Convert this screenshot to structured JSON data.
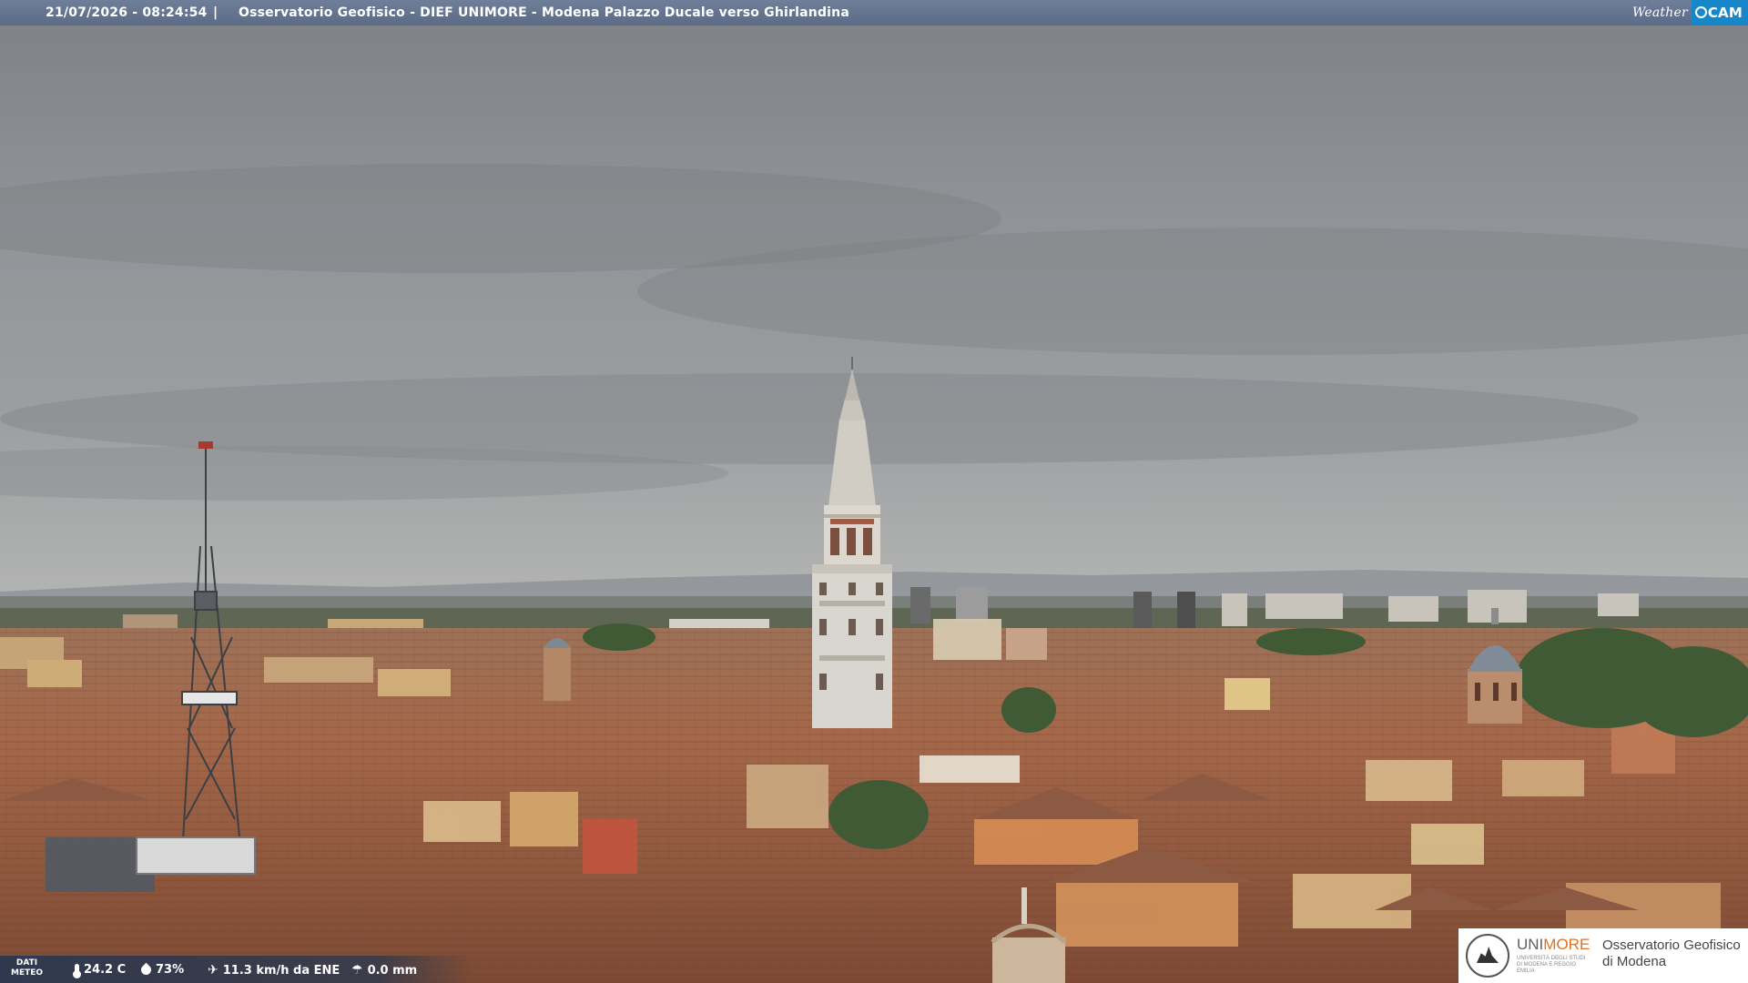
{
  "header": {
    "timestamp": "21/07/2026 - 08:24:54",
    "separator": "|",
    "caption": "Osservatorio Geofisico - DIEF UNIMORE - Modena Palazzo Ducale verso Ghirlandina",
    "brand_weather": "Weather",
    "brand_cam": "CAM"
  },
  "weather": {
    "label_line1": "DATI",
    "label_line2": "METEO",
    "temperature": "24.2 C",
    "humidity": "73%",
    "wind": "11.3 km/h da ENE",
    "rain": "0.0 mm"
  },
  "logo": {
    "uni_a": "UNI",
    "uni_b": "MORE",
    "uni_sub": "UNIVERSITÀ DEGLI STUDI DI MODENA E REGGIO EMILIA",
    "obs_line1": "Osservatorio Geofisico",
    "obs_line2": "di Modena"
  },
  "colors": {
    "sky": "#8d9196",
    "roofs": "#a8694a",
    "tower": "#d9d6cf",
    "bar": "#5b6b86",
    "brand_accent": "#1787c9",
    "unimore_orange": "#e2701f"
  }
}
